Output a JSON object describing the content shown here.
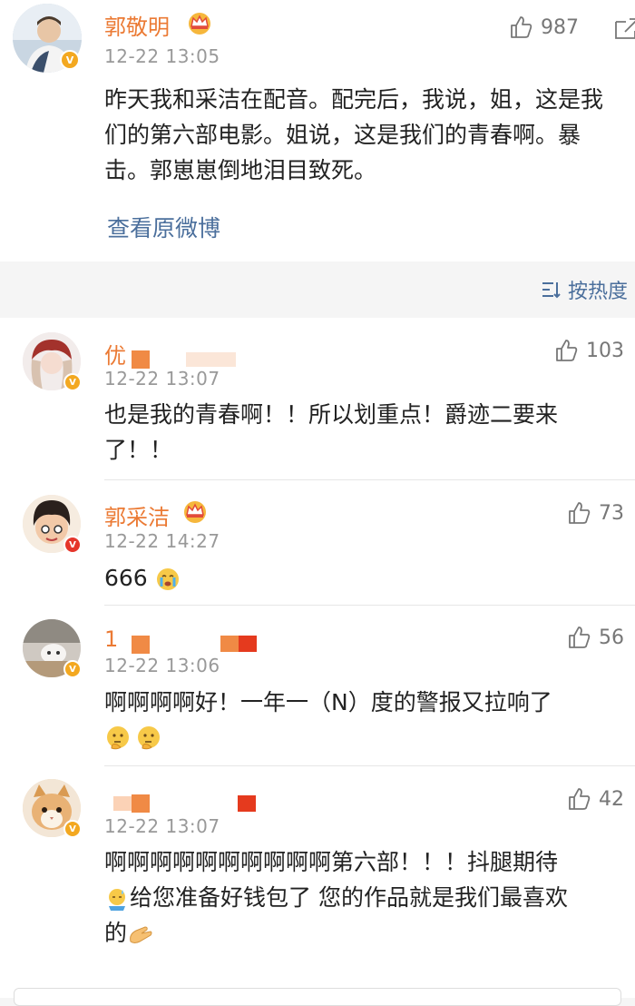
{
  "post": {
    "author": "郭敬明",
    "time": "12-22 13:05",
    "likes": "987",
    "text": "昨天我和采洁在配音。配完后，我说，姐，这是我们的第六部电影。姐说，这是我们的青春啊。暴击。郭崽崽倒地泪目致死。",
    "view_original": "查看原微博"
  },
  "sort_label": "按热度",
  "comments": [
    {
      "name": "优",
      "time": "12-22 13:07",
      "likes": "103",
      "text": "也是我的青春啊！！所以划重点！爵迹二要来了！！"
    },
    {
      "name": "郭采洁",
      "time": "12-22 14:27",
      "likes": "73",
      "text": "666"
    },
    {
      "name": "1",
      "time": "12-22 13:06",
      "likes": "56",
      "text": "啊啊啊啊好！一年一（N）度的警报又拉响了"
    },
    {
      "name": "",
      "time": "12-22 13:07",
      "likes": "42",
      "text1": "啊啊啊啊啊啊啊啊啊啊第六部！！！抖腿期待",
      "text2": "给您准备好钱包了 您的作品就是我们最喜欢",
      "text3": "的"
    }
  ],
  "colors": {
    "name": "#eb7a34",
    "link": "#4b6f9c",
    "vip_badge": "#f3a820",
    "red_badge": "#e5352a"
  },
  "icons": [
    "thumbs-up-icon",
    "crown-icon",
    "sort-icon",
    "crying-emoji",
    "thinking-emoji",
    "clap-emoji"
  ]
}
